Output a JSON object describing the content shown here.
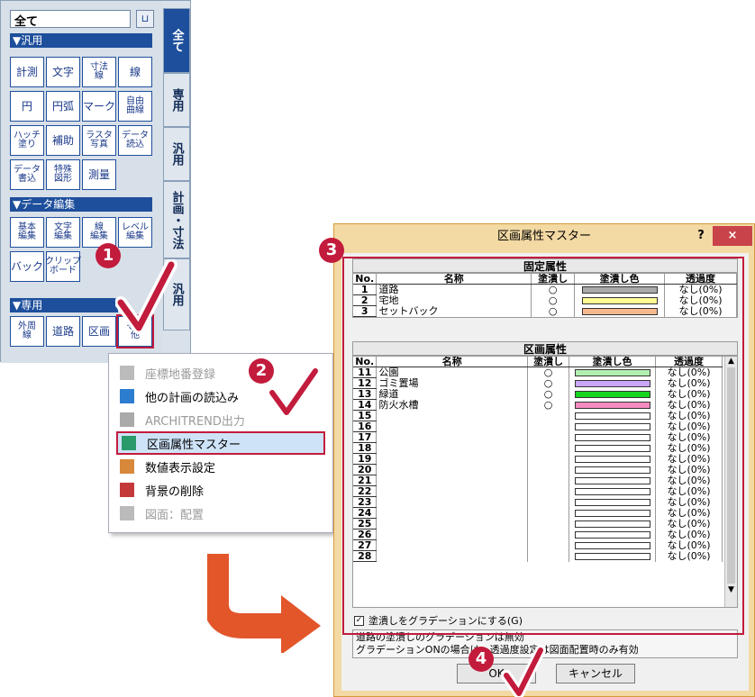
{
  "palette": {
    "combo_value": "全て",
    "pin_glyph": "⊔",
    "sections": [
      "▼汎用",
      "▼データ編集",
      "▼専用"
    ],
    "general_tools": [
      "計測",
      "文字",
      "寸法\n線",
      "線",
      "円",
      "円弧",
      "マーク",
      "自由\n曲線",
      "ハッチ\n塗り",
      "補助",
      "ラスタ\n写真",
      "データ\n読込",
      "データ\n書込",
      "特殊\n図形",
      "測量"
    ],
    "edit_tools": [
      "基本\n編集",
      "文字\n編集",
      "線\n編集",
      "レベル\n編集",
      "バック",
      "クリップ\nボード"
    ],
    "special_tools": [
      "外周\n線",
      "道路",
      "区画",
      "その\n他"
    ],
    "tabs": [
      "全て",
      "専用",
      "汎用",
      "計画・寸法",
      "汎用"
    ]
  },
  "context_menu": {
    "items": [
      {
        "label": "座標地番登録",
        "disabled": true,
        "icon": "grid-icon"
      },
      {
        "label": "他の計画の読込み",
        "disabled": false,
        "icon": "color-grid-icon"
      },
      {
        "label": "ARCHITREND出力",
        "disabled": true,
        "icon": "architrend-icon"
      },
      {
        "label": "区画属性マスター",
        "disabled": false,
        "icon": "lot-attribute-icon"
      },
      {
        "label": "数値表示設定",
        "disabled": false,
        "icon": "numeric-display-icon"
      },
      {
        "label": "背景の削除",
        "disabled": false,
        "icon": "background-delete-icon"
      },
      {
        "label": "図面：配置",
        "disabled": true,
        "icon": "drawing-layout-icon"
      }
    ]
  },
  "dialog": {
    "title": "区画属性マスター",
    "help": "?",
    "close": "×",
    "fixed_group_title": "固定属性",
    "lot_group_title": "区画属性",
    "columns": {
      "no": "No.",
      "name": "名称",
      "fill": "塗潰し",
      "fill_color": "塗潰し色",
      "transparency": "透過度"
    },
    "fixed_rows": [
      {
        "no": "1",
        "name": "道路",
        "fill": "○",
        "color": "#a9a9a9",
        "transparency": "なし(0%)"
      },
      {
        "no": "2",
        "name": "宅地",
        "fill": "○",
        "color": "#fffb93",
        "transparency": "なし(0%)"
      },
      {
        "no": "3",
        "name": "セットバック",
        "fill": "○",
        "color": "#f6b98e",
        "transparency": "なし(0%)"
      }
    ],
    "lot_rows": [
      {
        "no": "11",
        "name": "公園",
        "fill": "○",
        "color": "#b2f0b2",
        "transparency": "なし(0%)"
      },
      {
        "no": "12",
        "name": "ゴミ置場",
        "fill": "○",
        "color": "#c9a6f7",
        "transparency": "なし(0%)"
      },
      {
        "no": "13",
        "name": "緑道",
        "fill": "○",
        "color": "#18d41e",
        "transparency": "なし(0%)"
      },
      {
        "no": "14",
        "name": "防火水槽",
        "fill": "○",
        "color": "#f58bc0",
        "transparency": "なし(0%)"
      },
      {
        "no": "15",
        "name": "",
        "fill": "",
        "color": "#ffffff",
        "transparency": "なし(0%)"
      },
      {
        "no": "16",
        "name": "",
        "fill": "",
        "color": "#ffffff",
        "transparency": "なし(0%)"
      },
      {
        "no": "17",
        "name": "",
        "fill": "",
        "color": "#ffffff",
        "transparency": "なし(0%)"
      },
      {
        "no": "18",
        "name": "",
        "fill": "",
        "color": "#ffffff",
        "transparency": "なし(0%)"
      },
      {
        "no": "19",
        "name": "",
        "fill": "",
        "color": "#ffffff",
        "transparency": "なし(0%)"
      },
      {
        "no": "20",
        "name": "",
        "fill": "",
        "color": "#ffffff",
        "transparency": "なし(0%)"
      },
      {
        "no": "21",
        "name": "",
        "fill": "",
        "color": "#ffffff",
        "transparency": "なし(0%)"
      },
      {
        "no": "22",
        "name": "",
        "fill": "",
        "color": "#ffffff",
        "transparency": "なし(0%)"
      },
      {
        "no": "23",
        "name": "",
        "fill": "",
        "color": "#ffffff",
        "transparency": "なし(0%)"
      },
      {
        "no": "24",
        "name": "",
        "fill": "",
        "color": "#ffffff",
        "transparency": "なし(0%)"
      },
      {
        "no": "25",
        "name": "",
        "fill": "",
        "color": "#ffffff",
        "transparency": "なし(0%)"
      },
      {
        "no": "26",
        "name": "",
        "fill": "",
        "color": "#ffffff",
        "transparency": "なし(0%)"
      },
      {
        "no": "27",
        "name": "",
        "fill": "",
        "color": "#ffffff",
        "transparency": "なし(0%)"
      },
      {
        "no": "28",
        "name": "",
        "fill": "",
        "color": "#ffffff",
        "transparency": "なし(0%)"
      }
    ],
    "gradation_checkbox": "塗潰しをグラデーションにする(G)",
    "note_line1": "道路の塗潰しのグラデーションは無効",
    "note_line2": "グラデーションONの場合は、透過度設定は図面配置時のみ有効",
    "ok": "OK",
    "cancel": "キャンセル"
  },
  "badges": [
    "1",
    "2",
    "3",
    "4"
  ],
  "colors": {
    "accent_red": "#c21b3c",
    "palette_blue": "#1e4f9c",
    "arrow_orange": "#e2562a",
    "dialog_frame": "#f3d9a3"
  }
}
